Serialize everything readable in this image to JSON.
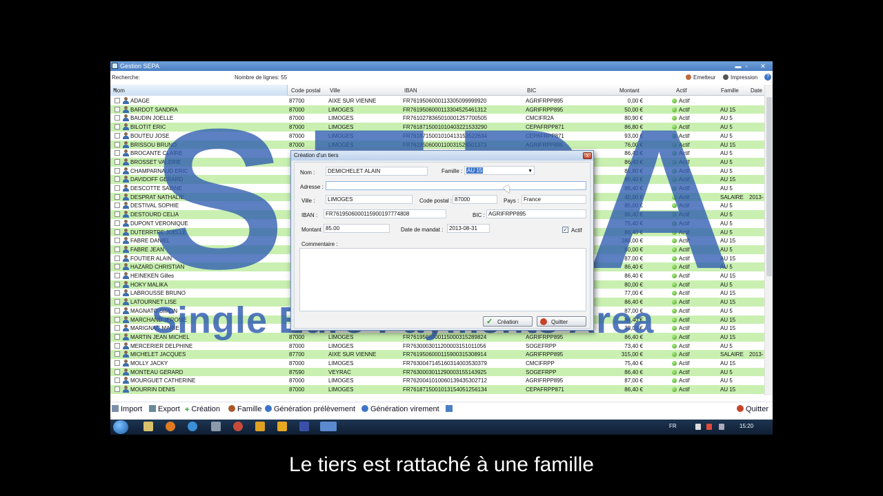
{
  "window": {
    "title": "Gestion SEPA",
    "min": "▬",
    "max": "▫",
    "close": "✕"
  },
  "toolbar": {
    "search_label": "Recherche:",
    "rows_count": "Nombre de lignes: 55",
    "emetteur": "Emetteur",
    "impression": "Impression",
    "help": "?"
  },
  "columns": {
    "nom": "Nom",
    "code_postal": "Code postal",
    "ville": "Ville",
    "iban": "IBAN",
    "bic": "BIC",
    "montant": "Montant",
    "actif": "Actif",
    "famille": "Famille",
    "date": "Date"
  },
  "rows": [
    {
      "nom": "ADAGE",
      "cp": "87700",
      "ville": "AIXE SUR VIENNE",
      "iban": "FR7619506000113305099999920",
      "bic": "AGRIFRPP895",
      "montant": "0,00 €",
      "actif": "Actif",
      "famille": "",
      "date": ""
    },
    {
      "nom": "BARDOT SANDRA",
      "cp": "87000",
      "ville": "LIMOGES",
      "iban": "FR7619506000113304525461312",
      "bic": "AGRIFRPP895",
      "montant": "50,00 €",
      "actif": "Actif",
      "famille": "AU 15",
      "date": ""
    },
    {
      "nom": "BAUDIN JOELLE",
      "cp": "87000",
      "ville": "LIMOGES",
      "iban": "FR7610278365010001257700505",
      "bic": "CMCIFR2A",
      "montant": "80,90 €",
      "actif": "Actif",
      "famille": "AU 5",
      "date": ""
    },
    {
      "nom": "BILOTIT ERIC",
      "cp": "87000",
      "ville": "LIMOGES",
      "iban": "FR7618715001010403221533290",
      "bic": "CEPAFRPP871",
      "montant": "86,80 €",
      "actif": "Actif",
      "famille": "AU 5",
      "date": ""
    },
    {
      "nom": "BOUTEU JOSE",
      "cp": "87000",
      "ville": "LIMOGES",
      "iban": "FR7618715001010413153522634",
      "bic": "CEPAFRPP871",
      "montant": "93,00 €",
      "actif": "Actif",
      "famille": "AU 5",
      "date": ""
    },
    {
      "nom": "BRISSOU BRUNO",
      "cp": "87000",
      "ville": "LIMOGES",
      "iban": "FR7619506000110031528501373",
      "bic": "AGRIFRPP895",
      "montant": "76,00 €",
      "actif": "Actif",
      "famille": "AU 15",
      "date": ""
    },
    {
      "nom": "BROCANTE CLAIRE",
      "cp": "",
      "ville": "",
      "iban": "",
      "bic": "",
      "montant": "86,40 €",
      "actif": "Actif",
      "famille": "AU 5",
      "date": ""
    },
    {
      "nom": "BROSSET VALERIE",
      "cp": "",
      "ville": "",
      "iban": "",
      "bic": "",
      "montant": "86,40 €",
      "actif": "Actif",
      "famille": "AU 5",
      "date": ""
    },
    {
      "nom": "CHAMPARNAUD ERIC",
      "cp": "",
      "ville": "",
      "iban": "",
      "bic": "",
      "montant": "85,80 €",
      "actif": "Actif",
      "famille": "AU 5",
      "date": ""
    },
    {
      "nom": "DAVIDOFF GERARD",
      "cp": "",
      "ville": "",
      "iban": "",
      "bic": "",
      "montant": "86,40 €",
      "actif": "Actif",
      "famille": "AU 15",
      "date": ""
    },
    {
      "nom": "DESCOTTE SABINE",
      "cp": "",
      "ville": "",
      "iban": "",
      "bic": "",
      "montant": "86,40 €",
      "actif": "Actif",
      "famille": "AU 5",
      "date": ""
    },
    {
      "nom": "DESPRAT NATHALIE",
      "cp": "",
      "ville": "",
      "iban": "",
      "bic": "",
      "montant": "40,00 €",
      "actif": "Actif",
      "famille": "SALAIRE",
      "date": "2013-"
    },
    {
      "nom": "DESTIVAL SOPHIE",
      "cp": "",
      "ville": "",
      "iban": "",
      "bic": "",
      "montant": "85,00 €",
      "actif": "Actif",
      "famille": "AU 5",
      "date": ""
    },
    {
      "nom": "DESTOURD CELIA",
      "cp": "",
      "ville": "",
      "iban": "",
      "bic": "",
      "montant": "86,40 €",
      "actif": "Actif",
      "famille": "AU 5",
      "date": ""
    },
    {
      "nom": "DUPONT VERONIQUE",
      "cp": "",
      "ville": "",
      "iban": "",
      "bic": "",
      "montant": "75,40 €",
      "actif": "Actif",
      "famille": "AU 5",
      "date": ""
    },
    {
      "nom": "DUTERRTRE JOELLE",
      "cp": "",
      "ville": "",
      "iban": "",
      "bic": "",
      "montant": "86,40 €",
      "actif": "Actif",
      "famille": "AU 5",
      "date": ""
    },
    {
      "nom": "FABRE DANIEL",
      "cp": "",
      "ville": "",
      "iban": "",
      "bic": "",
      "montant": "280,00 €",
      "actif": "Actif",
      "famille": "AU 15",
      "date": ""
    },
    {
      "nom": "FABRE JEAN",
      "cp": "",
      "ville": "",
      "iban": "",
      "bic": "",
      "montant": "80,00 €",
      "actif": "Actif",
      "famille": "AU 5",
      "date": ""
    },
    {
      "nom": "FOUTIER ALAIN",
      "cp": "",
      "ville": "",
      "iban": "",
      "bic": "",
      "montant": "87,00 €",
      "actif": "Actif",
      "famille": "AU 15",
      "date": ""
    },
    {
      "nom": "HAZARD CHRISTIAN",
      "cp": "",
      "ville": "",
      "iban": "",
      "bic": "",
      "montant": "86,40 €",
      "actif": "Actif",
      "famille": "AU 5",
      "date": ""
    },
    {
      "nom": "HEINEKEN Gilles",
      "cp": "",
      "ville": "",
      "iban": "",
      "bic": "",
      "montant": "86,40 €",
      "actif": "Actif",
      "famille": "AU 15",
      "date": ""
    },
    {
      "nom": "HOKY MALIKA",
      "cp": "",
      "ville": "",
      "iban": "",
      "bic": "",
      "montant": "80,00 €",
      "actif": "Actif",
      "famille": "AU 5",
      "date": ""
    },
    {
      "nom": "LABROUSSE BRUNO",
      "cp": "",
      "ville": "",
      "iban": "",
      "bic": "",
      "montant": "77,00 €",
      "actif": "Actif",
      "famille": "AU 15",
      "date": ""
    },
    {
      "nom": "LATOURNET LISE",
      "cp": "",
      "ville": "",
      "iban": "",
      "bic": "",
      "montant": "86,40 €",
      "actif": "Actif",
      "famille": "AU 15",
      "date": ""
    },
    {
      "nom": "MAGNATO SIMON",
      "cp": "",
      "ville": "",
      "iban": "",
      "bic": "",
      "montant": "87,00 €",
      "actif": "Actif",
      "famille": "AU 5",
      "date": ""
    },
    {
      "nom": "MARCHAND JEROME",
      "cp": "",
      "ville": "",
      "iban": "",
      "bic": "",
      "montant": "86,40 €",
      "actif": "Actif",
      "famille": "AU 15",
      "date": ""
    },
    {
      "nom": "MARIGNAC MARIE",
      "cp": "",
      "ville": "",
      "iban": "",
      "bic": "",
      "montant": "38,00 €",
      "actif": "Actif",
      "famille": "AU 15",
      "date": ""
    },
    {
      "nom": "MARTIN JEAN MICHEL",
      "cp": "87000",
      "ville": "LIMOGES",
      "iban": "FR7619506000115000315289824",
      "bic": "AGRIFRPP895",
      "montant": "86,40 €",
      "actif": "Actif",
      "famille": "AU 15",
      "date": ""
    },
    {
      "nom": "MERCERIER DELPHINE",
      "cp": "87000",
      "ville": "LIMOGES",
      "iban": "FR7630003011200003151011056",
      "bic": "SOGEFRPP",
      "montant": "73,40 €",
      "actif": "Actif",
      "famille": "AU 5",
      "date": ""
    },
    {
      "nom": "MICHELET JACQUES",
      "cp": "87700",
      "ville": "AIXE SUR VIENNE",
      "iban": "FR7619506000115900315308914",
      "bic": "AGRIFRPP895",
      "montant": "315,00 €",
      "actif": "Actif",
      "famille": "SALAIRE",
      "date": "2013-"
    },
    {
      "nom": "MOLLY JACKY",
      "cp": "87000",
      "ville": "LIMOGES",
      "iban": "FR7630047145160314003530379",
      "bic": "CMCIFRPP",
      "montant": "75,40 €",
      "actif": "Actif",
      "famille": "AU 15",
      "date": ""
    },
    {
      "nom": "MONTEAU GERARD",
      "cp": "87590",
      "ville": "VEYRAC",
      "iban": "FR7630003011290003155143925",
      "bic": "SOGEFRPP",
      "montant": "86,40 €",
      "actif": "Actif",
      "famille": "AU 5",
      "date": ""
    },
    {
      "nom": "MOURGUET CATHERINE",
      "cp": "87000",
      "ville": "LIMOGES",
      "iban": "FR7620041010060139435302712",
      "bic": "AGRIFRPP895",
      "montant": "87,00 €",
      "actif": "Actif",
      "famille": "AU 5",
      "date": ""
    },
    {
      "nom": "MOURRIN DENIS",
      "cp": "87000",
      "ville": "LIMOGES",
      "iban": "FR7618715001013154051256134",
      "bic": "CEPAFRPP871",
      "montant": "86,40 €",
      "actif": "Actif",
      "famille": "AU 15",
      "date": ""
    }
  ],
  "watermark": {
    "letters": "SEPA",
    "tagline": "Single Euro Payments Area"
  },
  "actions": {
    "import": "Import",
    "export": "Export",
    "creation": "Création",
    "famille": "Famille",
    "gen_prelevement": "Génération prélèvement",
    "gen_virement": "Génération virement",
    "quitter": "Quitter"
  },
  "taskbar": {
    "lang": "FR",
    "clock": "15:20"
  },
  "dialog": {
    "title": "Création d'un tiers",
    "close": "x",
    "nom_label": "Nom :",
    "nom_value": "DEMICHELET ALAIN",
    "famille_label": "Famille :",
    "famille_value": "AU 15",
    "adresse_label": "Adresse :",
    "adresse_value": "",
    "ville_label": "Ville :",
    "ville_value": "LIMOGES",
    "cp_label": "Code postal :",
    "cp_value": "87000",
    "pays_label": "Pays :",
    "pays_value": "France",
    "iban_label": "IBAN :",
    "iban_value": "FR7619506000115900197774808",
    "bic_label": "BIC :",
    "bic_value": "AGRIFRPP895",
    "montant_label": "Montant :",
    "montant_value": "85.00",
    "date_label": "Date de mandat :",
    "date_value": "2013-08-31",
    "actif_label": "Actif",
    "actif_check": "✓",
    "commentaire_label": "Commentaire :",
    "creation_btn": "Création",
    "quitter_btn": "Quitter"
  },
  "caption": "Le tiers est rattaché à une famille",
  "colors": {
    "row_alt": "#c9f0b1",
    "watermark": "#2e5cb0",
    "titlebar": "#4a7fc4"
  }
}
